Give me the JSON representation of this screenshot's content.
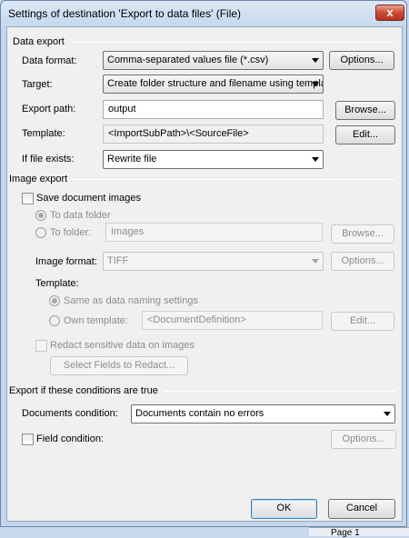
{
  "window": {
    "title": "Settings of destination 'Export to data files' (File)",
    "close_glyph": "x"
  },
  "data_export": {
    "heading": "Data export",
    "format_label": "Data format:",
    "format_value": "Comma-separated values file (*.csv)",
    "format_options_button": "Options...",
    "target_label": "Target:",
    "target_value": "Create folder structure and filename using template",
    "export_path_label": "Export path:",
    "export_path_value": "output",
    "browse_button": "Browse...",
    "template_label": "Template:",
    "template_value": "<ImportSubPath>\\<SourceFile>",
    "edit_button": "Edit...",
    "if_exists_label": "If file exists:",
    "if_exists_value": "Rewrite file"
  },
  "image_export": {
    "heading": "Image export",
    "save_images_label": "Save document images",
    "to_data_folder_label": "To data folder",
    "to_folder_label": "To folder:",
    "to_folder_value": "Images",
    "browse_button": "Browse...",
    "image_format_label": "Image format:",
    "image_format_value": "TIFF",
    "options_button": "Options...",
    "template_heading": "Template:",
    "same_as_label": "Same as data naming settings",
    "own_template_label": "Own template:",
    "own_template_value": "<DocumentDefinition>",
    "edit_button": "Edit...",
    "redact_label": "Redact sensitive data on images",
    "select_fields_button": "Select Fields to Redact..."
  },
  "conditions": {
    "heading": "Export if these conditions are true",
    "documents_condition_label": "Documents condition:",
    "documents_condition_value": "Documents contain no errors",
    "field_condition_label": "Field condition:",
    "options_button": "Options..."
  },
  "footer": {
    "ok_button": "OK",
    "cancel_button": "Cancel"
  },
  "background": {
    "page_label": "Page 1"
  }
}
